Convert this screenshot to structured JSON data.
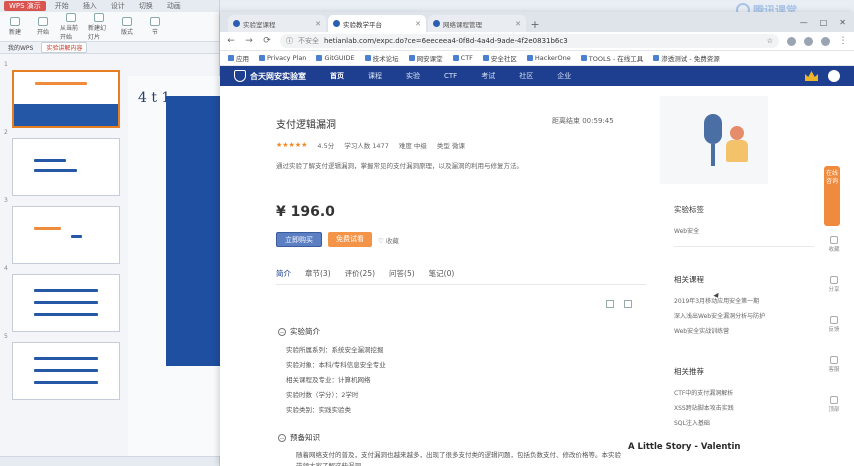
{
  "wps": {
    "tabs": [
      "WPS 演示",
      "开始",
      "插入",
      "设计",
      "切换",
      "动画",
      "放映",
      "审阅",
      "视图"
    ],
    "ribbon": [
      "新建",
      "开始",
      "从当前开始",
      "新建幻灯片",
      "版式",
      "节",
      "重置"
    ],
    "doc_tabs": [
      "我的WPS",
      "实验讲解内容"
    ],
    "slides": [
      "1",
      "2",
      "3",
      "4",
      "5"
    ],
    "slide_text": "4 t 1"
  },
  "browser": {
    "tabs": [
      "实验室课程",
      "实验教学平台",
      "网络课程管理"
    ],
    "address_prefix": "不安全",
    "url": "hetianlab.com/expc.do?ce=6eeceea4-0f8d-4a4d-9ade-4f2e0831b6c3",
    "bookmarks": [
      "应用",
      "Privacy Plan",
      "GitGUIDE",
      "技术论坛",
      "网安课堂",
      "CTF",
      "安全社区",
      "HackerOne",
      "TOOLS - 在线工具",
      "渗透测试 - 免费资源",
      "Linux下常用工具"
    ],
    "win_buttons": [
      "—",
      "□",
      "✕"
    ]
  },
  "site": {
    "logo": "合天网安实验室",
    "nav": [
      "首页",
      "课程",
      "实验",
      "CTF",
      "考试",
      "社区",
      "企业",
      "证书"
    ],
    "corner_logo": "腾讯课堂"
  },
  "course": {
    "title": "支付逻辑漏洞",
    "countdown": "距离结束 00:59:45",
    "stars": "★★★★★",
    "rating": "4.5分",
    "students": "学习人数 1477",
    "difficulty": "难度 中级",
    "type": "类型 微课",
    "desc": "通过实验了解支付逻辑漏洞，掌握常见的支付漏洞原理，以及漏洞的利用与修复方法。",
    "price": "¥ 196.0",
    "btn_buy": "立即购买",
    "btn_trial": "免费试看",
    "fav": "收藏",
    "tabs": [
      "简介",
      "章节(3)",
      "评价(25)",
      "问答(5)",
      "笔记(0)"
    ],
    "section1": "实验简介",
    "info": [
      "实验所属系列：系统安全漏洞挖掘",
      "实验对象：本科/专科信息安全专业",
      "相关课程及专业：计算机网络",
      "实验时数（学分）：2学时",
      "实验类别：实践实验类"
    ],
    "section2": "预备知识",
    "knowledge": "随着网络支付的普及，支付漏洞也越来越多，出现了很多支付类的逻辑问题，包括负数支付、修改价格等。本实验带领大家了解这些漏洞。",
    "watermark": "A Little Story - Valentin"
  },
  "sidebar": {
    "h1": "实验标签",
    "tag": "Web安全",
    "h2": "相关课程",
    "courses": [
      "2019年3月移动应用安全第一期",
      "深入浅出Web安全漏洞分析与防护",
      "Web安全实战训练营"
    ],
    "h3": "相关推荐",
    "recs": [
      "CTF中的支付漏洞解析",
      "XSS跨站脚本攻击实践",
      "SQL注入基础"
    ]
  },
  "floatbar": {
    "top": "在线咨询",
    "items": [
      "收藏",
      "分享",
      "反馈",
      "客服",
      "顶部"
    ]
  }
}
